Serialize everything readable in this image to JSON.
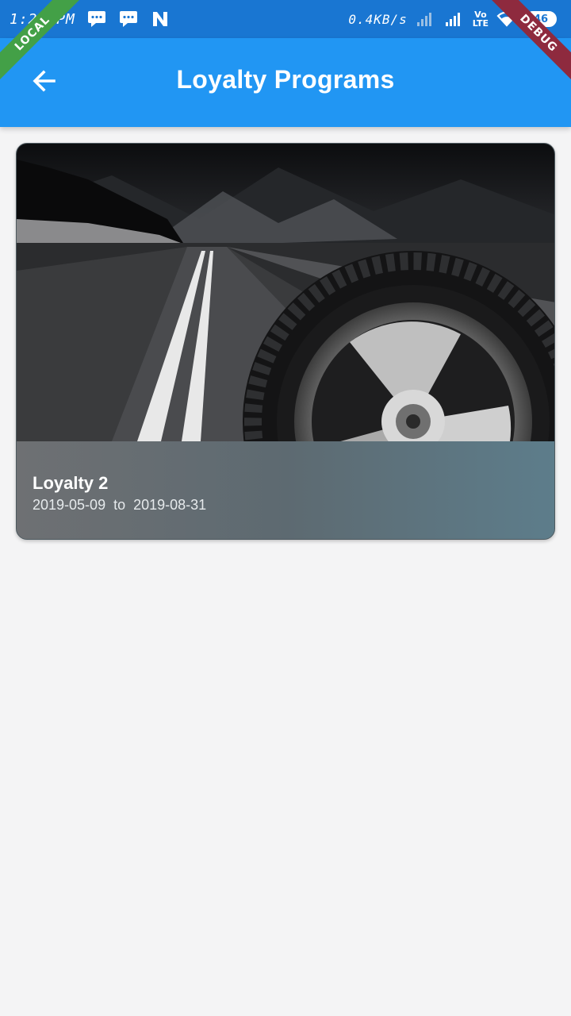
{
  "status_bar": {
    "time": "1:28 PM",
    "speed": "0.4KB/s",
    "volte_top": "Vo",
    "volte_bottom": "LTE",
    "battery": "46",
    "icons": [
      "message-icon",
      "message-icon",
      "n-app-icon",
      "signal-icon",
      "signal-icon",
      "wifi-icon",
      "battery-icon"
    ]
  },
  "ribbons": {
    "local": "LOCAL",
    "debug": "DEBUG"
  },
  "app_bar": {
    "title": "Loyalty Programs",
    "back_icon": "arrow-back-icon",
    "color": "#2196f3"
  },
  "programs": [
    {
      "name": "Loyalty 2",
      "start_date": "2019-05-09",
      "separator": "to",
      "end_date": "2019-08-31",
      "image": "tyre-on-road-image"
    }
  ],
  "colors": {
    "status_bar": "#1976d2",
    "app_bar": "#2196f3",
    "background": "#f4f4f5",
    "local_ribbon": "#43a047",
    "debug_ribbon": "#8e2a3e"
  }
}
